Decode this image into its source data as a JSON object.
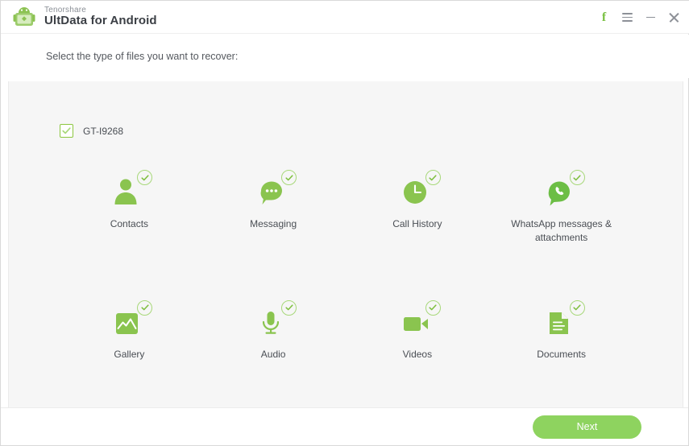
{
  "window": {
    "brand_top": "Tenorshare",
    "brand_main": "UltData for Android",
    "logo_icon": "android-robot-logo-icon",
    "controls": [
      {
        "name": "facebook-button",
        "icon": "facebook-f-icon",
        "label": "f"
      },
      {
        "name": "menu-button",
        "icon": "hamburger-menu-icon",
        "label": ""
      },
      {
        "name": "minimize-button",
        "icon": "minimize-icon",
        "label": ""
      },
      {
        "name": "close-button",
        "icon": "close-icon",
        "label": ""
      }
    ]
  },
  "header": {
    "prompt": "Select the type of files you want to recover:"
  },
  "device": {
    "checkbox_icon": "checkmark-icon",
    "checked": true,
    "label": "GT-I9268"
  },
  "file_types": [
    {
      "id": "contacts",
      "label": "Contacts",
      "icon": "contacts-icon",
      "selected": true
    },
    {
      "id": "messaging",
      "label": "Messaging",
      "icon": "messaging-icon",
      "selected": true
    },
    {
      "id": "call-history",
      "label": "Call History",
      "icon": "call-history-icon",
      "selected": true
    },
    {
      "id": "whatsapp",
      "label": "WhatsApp messages & attachments",
      "icon": "whatsapp-icon",
      "selected": true
    },
    {
      "id": "gallery",
      "label": "Gallery",
      "icon": "gallery-icon",
      "selected": true
    },
    {
      "id": "audio",
      "label": "Audio",
      "icon": "audio-icon",
      "selected": true
    },
    {
      "id": "videos",
      "label": "Videos",
      "icon": "videos-icon",
      "selected": true
    },
    {
      "id": "documents",
      "label": "Documents",
      "icon": "documents-icon",
      "selected": true
    }
  ],
  "footer": {
    "next_label": "Next"
  },
  "colors": {
    "accent_green": "#8ac44f",
    "button_green": "#8ed35f",
    "badge_green": "#a8d87a",
    "panel_gray": "#f6f6f6",
    "text_dark": "#4a4e54"
  }
}
